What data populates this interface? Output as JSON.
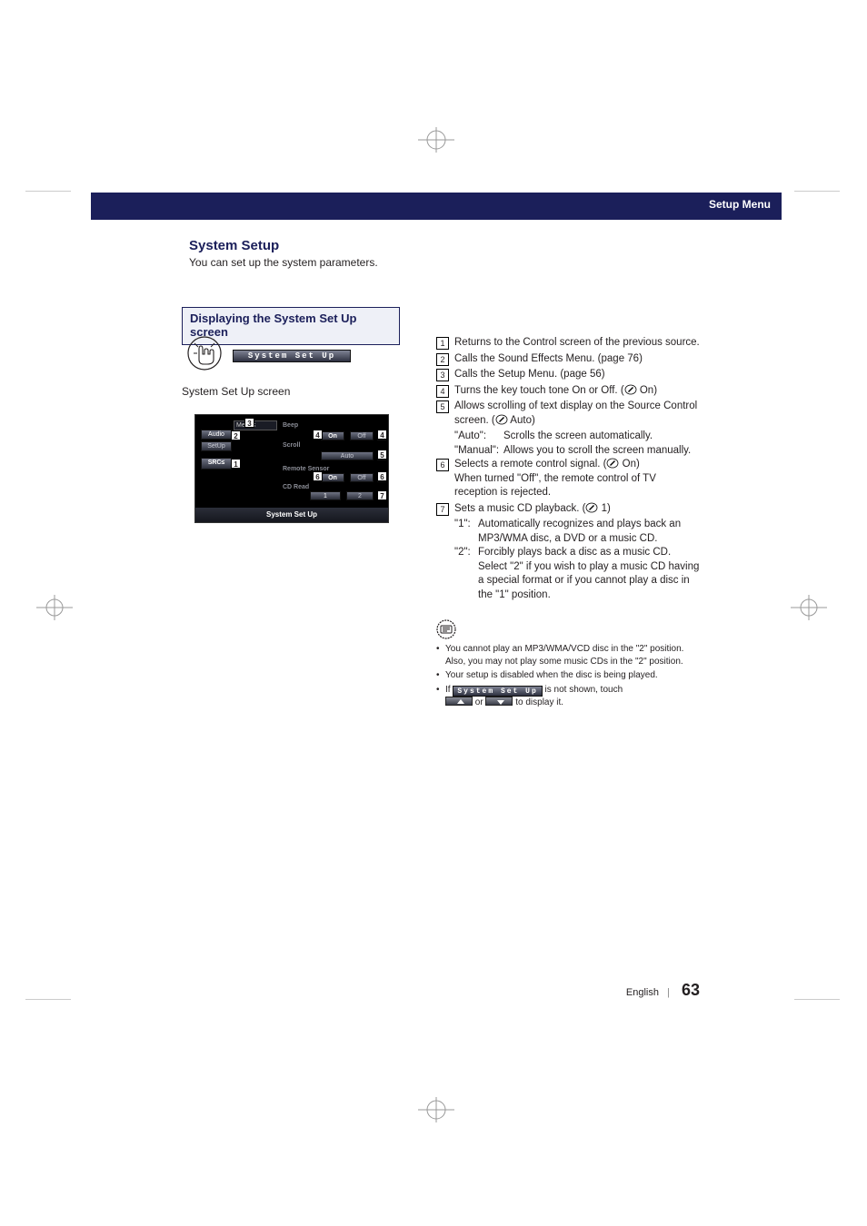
{
  "header": {
    "chapter": "Setup Menu"
  },
  "section": {
    "title": "System Setup",
    "subtitle": "You can set up the system parameters."
  },
  "box_heading": "Displaying the System Set Up screen",
  "touch_button_label": "System Set Up",
  "caption": "System Set Up screen",
  "screen": {
    "menu_tab": "Menu≤",
    "tabs": {
      "audio": "Audio",
      "setup": "SetUp",
      "src": "SRC≤"
    },
    "rows": {
      "beep": {
        "label": "Beep",
        "on": "On",
        "off": "Off"
      },
      "scroll": {
        "label": "Scroll",
        "auto": "Auto"
      },
      "remote": {
        "label": "Remote Sensor",
        "on": "On",
        "off": "Off"
      },
      "cdread": {
        "label": "CD Read",
        "opt1": "1",
        "opt2": "2"
      }
    },
    "strip": "System Set Up"
  },
  "callouts": {
    "c1": "1",
    "c2": "2",
    "c3": "3",
    "c4": "4",
    "c5": "5",
    "c6": "6",
    "c7": "7"
  },
  "desc": {
    "i1": {
      "n": "1",
      "t": "Returns to the Control screen of the previous source."
    },
    "i2": {
      "n": "2",
      "t": "Calls the Sound Effects Menu. (page 76)"
    },
    "i3": {
      "n": "3",
      "t": "Calls the Setup Menu. (page 56)"
    },
    "i4": {
      "n": "4",
      "t_pre": "Turns the key touch tone On or Off. (",
      "def": " On",
      "t_post": ")"
    },
    "i5": {
      "n": "5",
      "line1_pre": "Allows scrolling of text display on the Source Control screen. (",
      "line1_def": " Auto",
      "line1_post": ")",
      "auto_k": "\"Auto\":",
      "auto_v": "Scrolls the screen automatically.",
      "manual_k": "\"Manual\":",
      "manual_v": "Allows you to scroll the screen manually."
    },
    "i6": {
      "n": "6",
      "line1_pre": "Selects a remote control signal. (",
      "line1_def": " On",
      "line1_post": ")",
      "line2": "When turned \"Off\", the remote control of TV reception is rejected."
    },
    "i7": {
      "n": "7",
      "line1_pre": "Sets a music CD playback. (",
      "line1_def": " 1",
      "line1_post": ")",
      "opt1_k": "\"1\":",
      "opt1_v": "Automatically recognizes and plays back an MP3/WMA disc, a DVD or a music CD.",
      "opt2_k": "\"2\":",
      "opt2_v": "Forcibly plays back a disc as a music CD.  Select \"2\" if you wish to play a music CD having a special format or if you cannot play a disc in the \"1\" position."
    }
  },
  "notes": {
    "n1": "You cannot play an MP3/WMA/VCD disc in the \"2\" position. Also, you may not play some music CDs in the \"2\" position.",
    "n2": "Your setup is disabled when the disc is being played.",
    "n3_pre": "If ",
    "n3_btn": "System Set Up",
    "n3_mid": " is not shown, touch ",
    "n3_or": " or ",
    "n3_end": " to display it."
  },
  "footer": {
    "lang": "English",
    "page": "63"
  }
}
